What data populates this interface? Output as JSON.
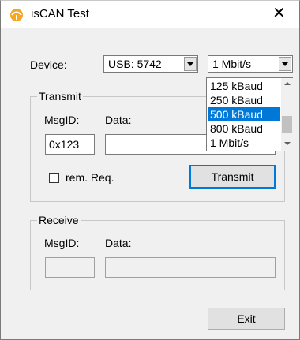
{
  "window": {
    "title": "isCAN Test",
    "close_glyph": "✕",
    "icon": "app-logo-icon"
  },
  "device": {
    "label": "Device:",
    "port_value": "USB: 5742",
    "bitrate_value": "1 Mbit/s",
    "bitrate_options": [
      "125 kBaud",
      "250 kBaud",
      "500 kBaud",
      "800 kBaud",
      "1 Mbit/s"
    ],
    "bitrate_highlighted_index": 2
  },
  "transmit": {
    "group_label": "Transmit",
    "msgid_label": "MsgID:",
    "data_label": "Data:",
    "msgid_value": "0x123",
    "data_value": "",
    "rem_req_label": "rem. Req.",
    "rem_req_checked": false,
    "button_label": "Transmit"
  },
  "receive": {
    "group_label": "Receive",
    "msgid_label": "MsgID:",
    "data_label": "Data:",
    "msgid_value": "",
    "data_value": ""
  },
  "exit_label": "Exit",
  "colors": {
    "accent": "#0078d7",
    "icon_orange": "#f5a623"
  }
}
